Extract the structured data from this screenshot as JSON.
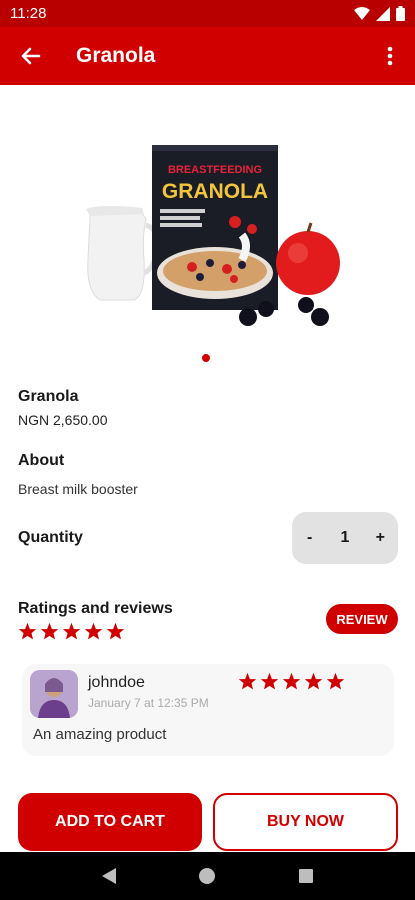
{
  "status_bar": {
    "time": "11:28"
  },
  "app_bar": {
    "title": "Granola",
    "back_icon": "arrow-left-icon",
    "more_icon": "more-vertical-icon"
  },
  "product": {
    "image_icon": "product-image",
    "box_text_top": "BREASTFEEDING",
    "box_text_main": "GRANOLA",
    "name": "Granola",
    "price": "NGN 2,650.00",
    "about_title": "About",
    "about_text": "Breast milk booster"
  },
  "carousel": {
    "active_index": 0,
    "count": 1
  },
  "quantity": {
    "label": "Quantity",
    "minus": "-",
    "value": "1",
    "plus": "+"
  },
  "ratings": {
    "title": "Ratings and reviews",
    "stars": 5,
    "review_button": "REVIEW"
  },
  "review": {
    "username": "johndoe",
    "date": "January 7 at 12:35 PM",
    "stars": 5,
    "text": "An amazing product"
  },
  "actions": {
    "add_to_cart": "ADD TO CART",
    "buy_now": "BUY NOW"
  },
  "colors": {
    "primary": "#d10000",
    "status_bar": "#b80000",
    "stepper_bg": "#e2e2e2"
  }
}
